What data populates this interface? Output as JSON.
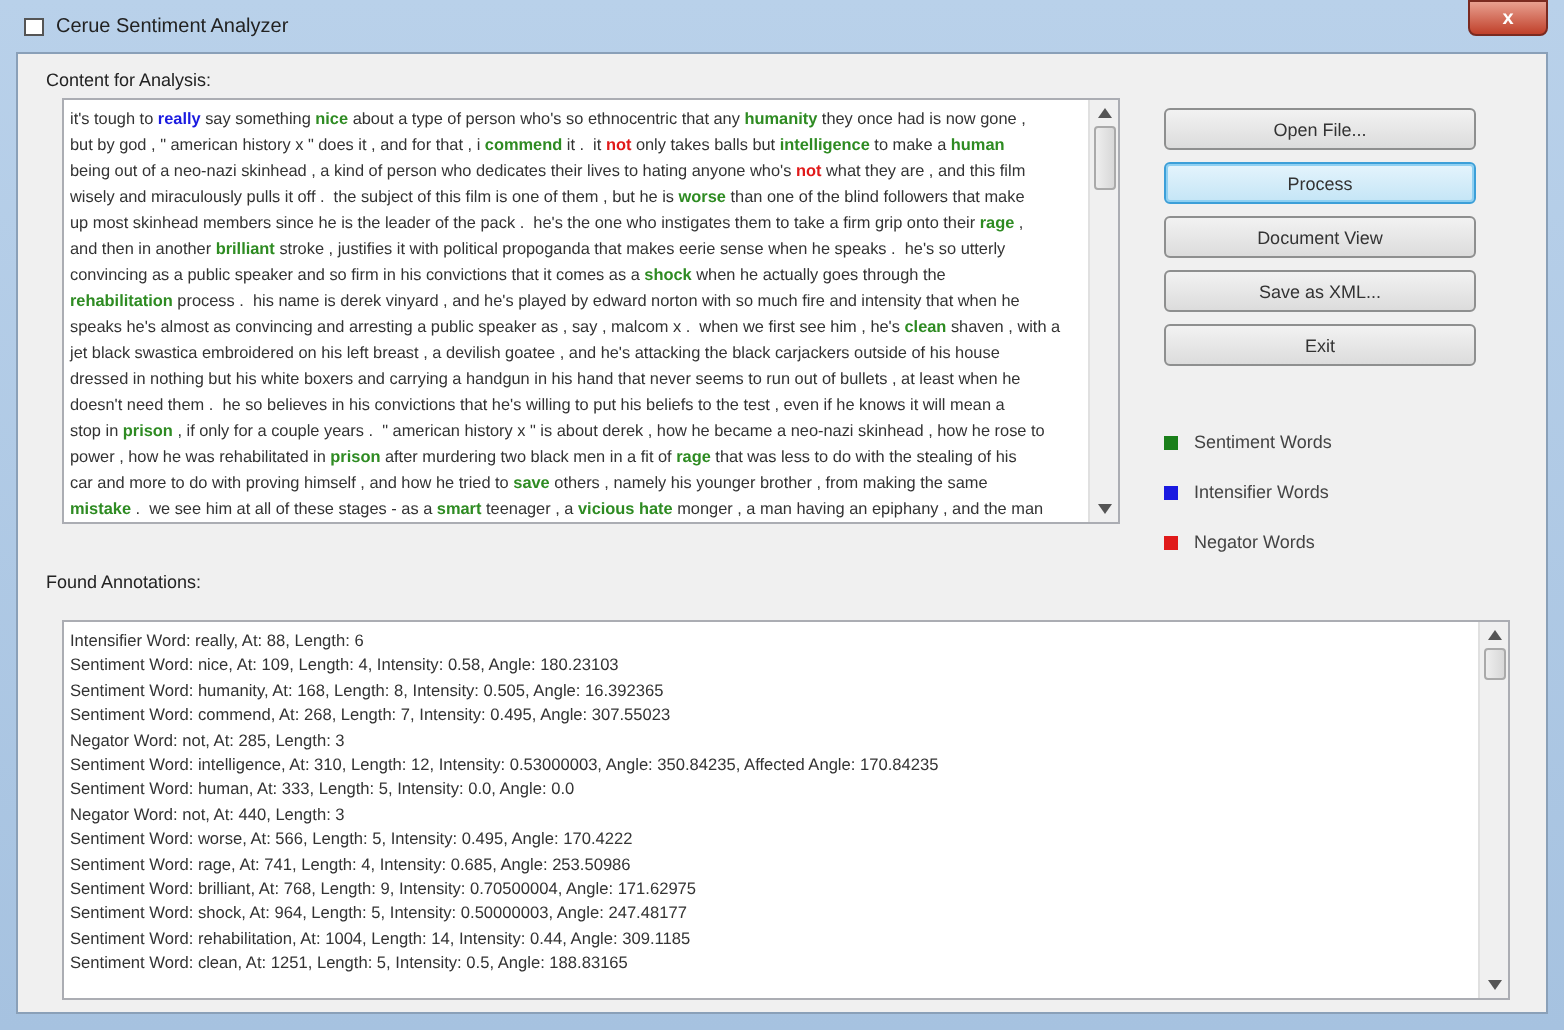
{
  "window": {
    "title": "Cerue Sentiment Analyzer",
    "close": "x"
  },
  "content": {
    "label": "Content for Analysis:",
    "lines": [
      [
        {
          "kind": "plain",
          "text": "it's tough to "
        },
        {
          "kind": "intensifier",
          "text": "really"
        },
        {
          "kind": "plain",
          "text": " say something "
        },
        {
          "kind": "sentiment",
          "text": "nice"
        },
        {
          "kind": "plain",
          "text": " about a type of person who's so ethnocentric that any "
        },
        {
          "kind": "sentiment",
          "text": "humanity"
        },
        {
          "kind": "plain",
          "text": " they once had is now gone ,"
        }
      ],
      [
        {
          "kind": "plain",
          "text": "but by god , \" american history x \" does it , and for that , i "
        },
        {
          "kind": "sentiment",
          "text": "commend"
        },
        {
          "kind": "plain",
          "text": " it .  it "
        },
        {
          "kind": "negator",
          "text": "not"
        },
        {
          "kind": "plain",
          "text": " only takes balls but "
        },
        {
          "kind": "sentiment",
          "text": "intelligence"
        },
        {
          "kind": "plain",
          "text": " to make a "
        },
        {
          "kind": "sentiment",
          "text": "human"
        }
      ],
      [
        {
          "kind": "plain",
          "text": "being out of a neo-nazi skinhead , a kind of person who dedicates their lives to hating anyone who's "
        },
        {
          "kind": "negator",
          "text": "not"
        },
        {
          "kind": "plain",
          "text": " what they are , and this film"
        }
      ],
      [
        {
          "kind": "plain",
          "text": "wisely and miraculously pulls it off .  the subject of this film is one of them , but he is "
        },
        {
          "kind": "sentiment",
          "text": "worse"
        },
        {
          "kind": "plain",
          "text": " than one of the blind followers that make"
        }
      ],
      [
        {
          "kind": "plain",
          "text": "up most skinhead members since he is the leader of the pack .  he's the one who instigates them to take a firm grip onto their "
        },
        {
          "kind": "sentiment",
          "text": "rage"
        },
        {
          "kind": "plain",
          "text": " ,"
        }
      ],
      [
        {
          "kind": "plain",
          "text": "and then in another "
        },
        {
          "kind": "sentiment",
          "text": "brilliant"
        },
        {
          "kind": "plain",
          "text": " stroke , justifies it with political propoganda that makes eerie sense when he speaks .  he's so utterly"
        }
      ],
      [
        {
          "kind": "plain",
          "text": "convincing as a public speaker and so firm in his convictions that it comes as a "
        },
        {
          "kind": "sentiment",
          "text": "shock"
        },
        {
          "kind": "plain",
          "text": " when he actually goes through the"
        }
      ],
      [
        {
          "kind": "sentiment",
          "text": "rehabilitation"
        },
        {
          "kind": "plain",
          "text": " process .  his name is derek vinyard , and he's played by edward norton with so much fire and intensity that when he"
        }
      ],
      [
        {
          "kind": "plain",
          "text": "speaks he's almost as convincing and arresting a public speaker as , say , malcom x .  when we first see him , he's "
        },
        {
          "kind": "sentiment",
          "text": "clean"
        },
        {
          "kind": "plain",
          "text": " shaven , with a"
        }
      ],
      [
        {
          "kind": "plain",
          "text": "jet black swastica embroidered on his left breast , a devilish goatee , and he's attacking the black carjackers outside of his house"
        }
      ],
      [
        {
          "kind": "plain",
          "text": "dressed in nothing but his white boxers and carrying a handgun in his hand that never seems to run out of bullets , at least when he"
        }
      ],
      [
        {
          "kind": "plain",
          "text": "doesn't need them .  he so believes in his convictions that he's willing to put his beliefs to the test , even if he knows it will mean a"
        }
      ],
      [
        {
          "kind": "plain",
          "text": "stop in "
        },
        {
          "kind": "sentiment",
          "text": "prison"
        },
        {
          "kind": "plain",
          "text": " , if only for a couple years .  \" american history x \" is about derek , how he became a neo-nazi skinhead , how he rose to"
        }
      ],
      [
        {
          "kind": "plain",
          "text": "power , how he was rehabilitated in "
        },
        {
          "kind": "sentiment",
          "text": "prison"
        },
        {
          "kind": "plain",
          "text": " after murdering two black men in a fit of "
        },
        {
          "kind": "sentiment",
          "text": "rage"
        },
        {
          "kind": "plain",
          "text": " that was less to do with the stealing of his"
        }
      ],
      [
        {
          "kind": "plain",
          "text": "car and more to do with proving himself , and how he tried to "
        },
        {
          "kind": "sentiment",
          "text": "save"
        },
        {
          "kind": "plain",
          "text": " others , namely his younger brother , from making the same"
        }
      ],
      [
        {
          "kind": "sentiment",
          "text": "mistake"
        },
        {
          "kind": "plain",
          "text": " .  we see him at all of these stages - as a "
        },
        {
          "kind": "sentiment",
          "text": "smart"
        },
        {
          "kind": "plain",
          "text": " teenager , a "
        },
        {
          "kind": "sentiment",
          "text": "vicious hate"
        },
        {
          "kind": "plain",
          "text": " monger , a man having an epiphany , and the man"
        }
      ]
    ]
  },
  "buttons": [
    {
      "label": "Open File...",
      "focused": false
    },
    {
      "label": "Process",
      "focused": true
    },
    {
      "label": "Document View",
      "focused": false
    },
    {
      "label": "Save as XML...",
      "focused": false
    },
    {
      "label": "Exit",
      "focused": false
    }
  ],
  "legend": [
    {
      "label": "Sentiment Words",
      "color": "#1a7f1a"
    },
    {
      "label": "Intensifier Words",
      "color": "#1a1ae0"
    },
    {
      "label": "Negator Words",
      "color": "#e01a1a"
    }
  ],
  "annotations": {
    "label": "Found Annotations:",
    "lines": [
      "Intensifier Word: really, At: 88, Length: 6",
      "Sentiment Word: nice, At: 109, Length: 4, Intensity: 0.58, Angle: 180.23103",
      "Sentiment Word: humanity, At: 168, Length: 8, Intensity: 0.505, Angle: 16.392365",
      "Sentiment Word: commend, At: 268, Length: 7, Intensity: 0.495, Angle: 307.55023",
      "Negator Word: not, At: 285, Length: 3",
      "Sentiment Word: intelligence, At: 310, Length: 12, Intensity: 0.53000003, Angle: 350.84235, Affected Angle: 170.84235",
      "Sentiment Word: human, At: 333, Length: 5, Intensity: 0.0, Angle: 0.0",
      "Negator Word: not, At: 440, Length: 3",
      "Sentiment Word: worse, At: 566, Length: 5, Intensity: 0.495, Angle: 170.4222",
      "Sentiment Word: rage, At: 741, Length: 4, Intensity: 0.685, Angle: 253.50986",
      "Sentiment Word: brilliant, At: 768, Length: 9, Intensity: 0.70500004, Angle: 171.62975",
      "Sentiment Word: shock, At: 964, Length: 5, Intensity: 0.50000003, Angle: 247.48177",
      "Sentiment Word: rehabilitation, At: 1004, Length: 14, Intensity: 0.44, Angle: 309.1185",
      "Sentiment Word: clean, At: 1251, Length: 5, Intensity: 0.5, Angle: 188.83165"
    ]
  }
}
